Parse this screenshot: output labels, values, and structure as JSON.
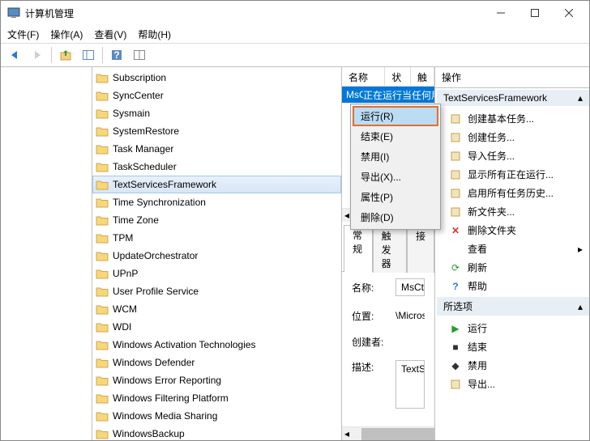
{
  "window": {
    "title": "计算机管理"
  },
  "menubar": [
    "文件(F)",
    "操作(A)",
    "查看(V)",
    "帮助(H)"
  ],
  "tree": {
    "items": [
      "Subscription",
      "SyncCenter",
      "Sysmain",
      "SystemRestore",
      "Task Manager",
      "TaskScheduler",
      "TextServicesFramework",
      "Time Synchronization",
      "Time Zone",
      "TPM",
      "UpdateOrchestrator",
      "UPnP",
      "User Profile Service",
      "WCM",
      "WDI",
      "Windows Activation Technologies",
      "Windows Defender",
      "Windows Error Reporting",
      "Windows Filtering Platform",
      "Windows Media Sharing",
      "WindowsBackup"
    ],
    "selected_index": 6
  },
  "tasklist": {
    "columns": [
      "名称",
      "状态",
      "触发器"
    ],
    "rows": [
      {
        "name": "MsCtfMoni...",
        "status": "正在运行",
        "trigger": "当任何用"
      }
    ]
  },
  "tabs": [
    "常规",
    "触发器",
    "接"
  ],
  "details": {
    "name_label": "名称:",
    "name_value": "MsCtfMonitor",
    "loc_label": "位置:",
    "loc_value": "\\Microsoft\\Windows\\",
    "author_label": "创建者:",
    "author_value": "",
    "desc_label": "描述:",
    "desc_value": "TextServicesFramewo"
  },
  "actions": {
    "title": "操作",
    "group1": "TextServicesFramework",
    "items1": [
      "创建基本任务...",
      "创建任务...",
      "导入任务...",
      "显示所有正在运行...",
      "启用所有任务历史...",
      "新文件夹...",
      "删除文件夹",
      "查看",
      "刷新",
      "帮助"
    ],
    "group2": "所选项",
    "items2": [
      "运行",
      "结束",
      "禁用",
      "导出..."
    ]
  },
  "context_menu": [
    "运行(R)",
    "结束(E)",
    "禁用(I)",
    "导出(X)...",
    "属性(P)",
    "删除(D)"
  ]
}
